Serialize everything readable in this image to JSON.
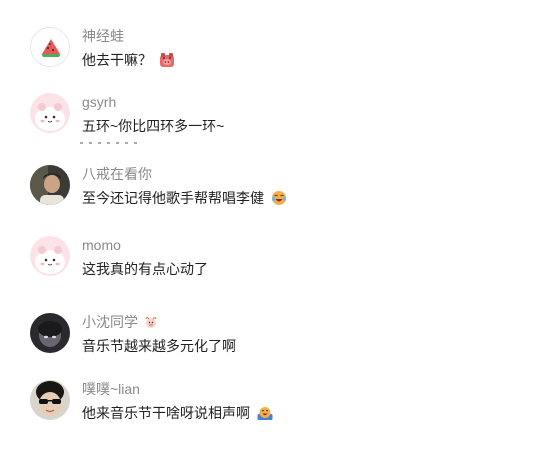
{
  "comments": [
    {
      "username": "神经蛙",
      "text": "他去干嘛？",
      "avatar_icon": "watermelon-avatar-icon",
      "emoji_icon": "pig-face-emoji-icon"
    },
    {
      "username": "gsyrh",
      "text": "五环~你比四环多一环~",
      "avatar_icon": "cute-pink-creature-avatar-icon"
    },
    {
      "username": "八戒在看你",
      "text": "至今还记得他歌手帮帮唱李健",
      "avatar_icon": "person-photo-avatar-icon",
      "emoji_icon": "laughing-crying-emoji-icon"
    },
    {
      "username": "momo",
      "text": "这我真的有点心动了",
      "avatar_icon": "cute-pink-creature-avatar-icon"
    },
    {
      "username": "小沈同学",
      "text": "音乐节越来越多元化了啊",
      "avatar_icon": "dark-photo-avatar-icon",
      "badge_icon": "ox-badge-icon"
    },
    {
      "username": "噗噗~lian",
      "text": "他来音乐节干啥呀说相声啊",
      "avatar_icon": "sunglasses-photo-avatar-icon",
      "emoji_icon": "laughing-rolling-emoji-icon"
    }
  ],
  "colors": {
    "username": "#8a8a8a",
    "message": "#222222",
    "background": "#ffffff"
  }
}
